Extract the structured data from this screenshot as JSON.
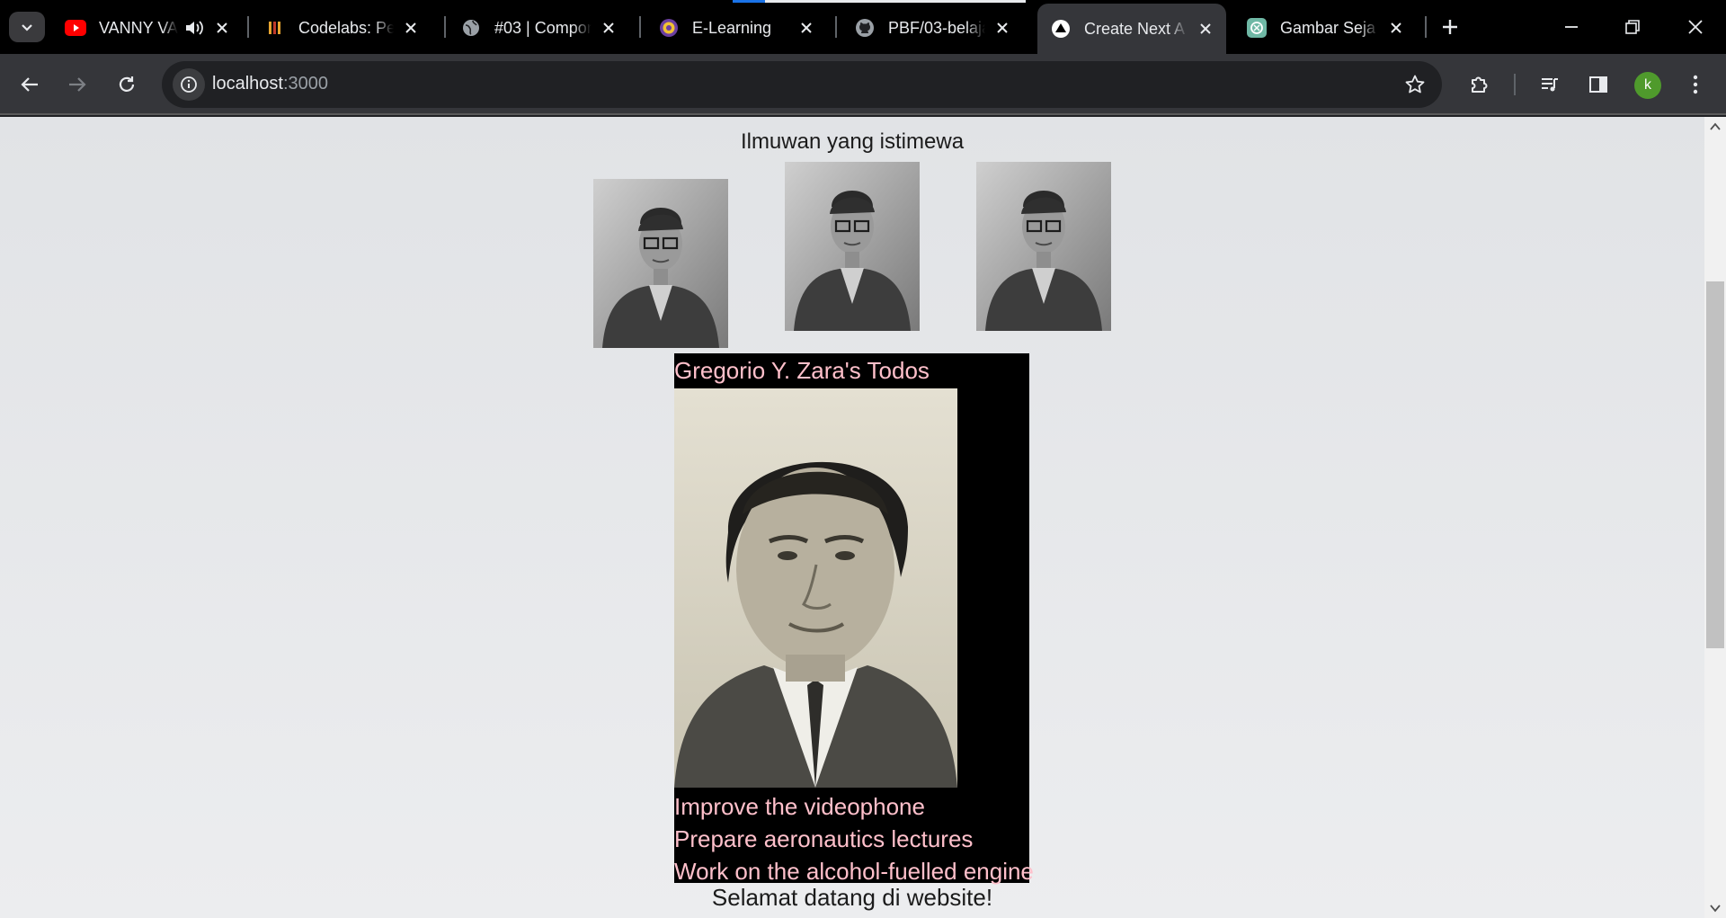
{
  "browser": {
    "tabs": [
      {
        "title": "VANNY VA",
        "favicon": "youtube-icon",
        "audio": true
      },
      {
        "title": "Codelabs: Pen",
        "favicon": "codelabs-icon"
      },
      {
        "title": "#03 | Compon",
        "favicon": "globe-icon"
      },
      {
        "title": "E-Learning",
        "favicon": "university-seal-icon"
      },
      {
        "title": "PBF/03-belaja",
        "favicon": "github-icon"
      },
      {
        "title": "Create Next A",
        "favicon": "nextjs-triangle-icon",
        "active": true
      },
      {
        "title": "Gambar Seja",
        "favicon": "chatgpt-icon"
      }
    ],
    "address_bar": {
      "host": "localhost",
      "port": ":3000"
    },
    "profile_initial": "k",
    "accent_colors": {
      "avatar": "#4f9a2c",
      "youtube": "#ff0000",
      "loading": "#1a73e8"
    }
  },
  "page": {
    "heading": "Ilmuwan yang istimewa",
    "gallery_portraits": [
      "scientist-portrait-1",
      "scientist-portrait-2",
      "scientist-portrait-3"
    ],
    "profile": {
      "name": "Gregorio Y. Zara's Todos",
      "todos": [
        "Improve the videophone",
        "Prepare aeronautics lectures",
        "Work on the alcohol-fuelled engine"
      ],
      "colors": {
        "background": "#000000",
        "text": "#ffc0cb"
      }
    },
    "welcome": "Selamat datang di website!"
  }
}
